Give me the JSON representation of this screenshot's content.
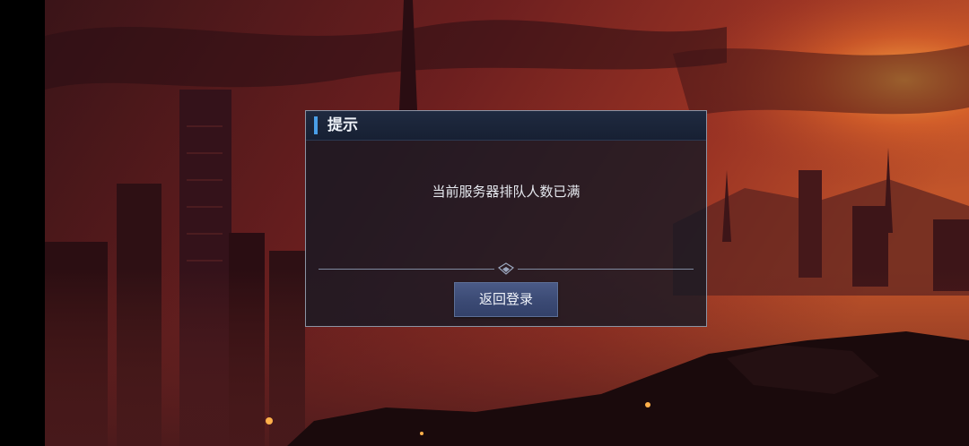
{
  "dialog": {
    "title": "提示",
    "message": "当前服务器排队人数已满",
    "confirm_label": "返回登录"
  },
  "colors": {
    "accent": "#4a9fe8",
    "button": "#3b4a74",
    "sky": "#8a2b25"
  }
}
